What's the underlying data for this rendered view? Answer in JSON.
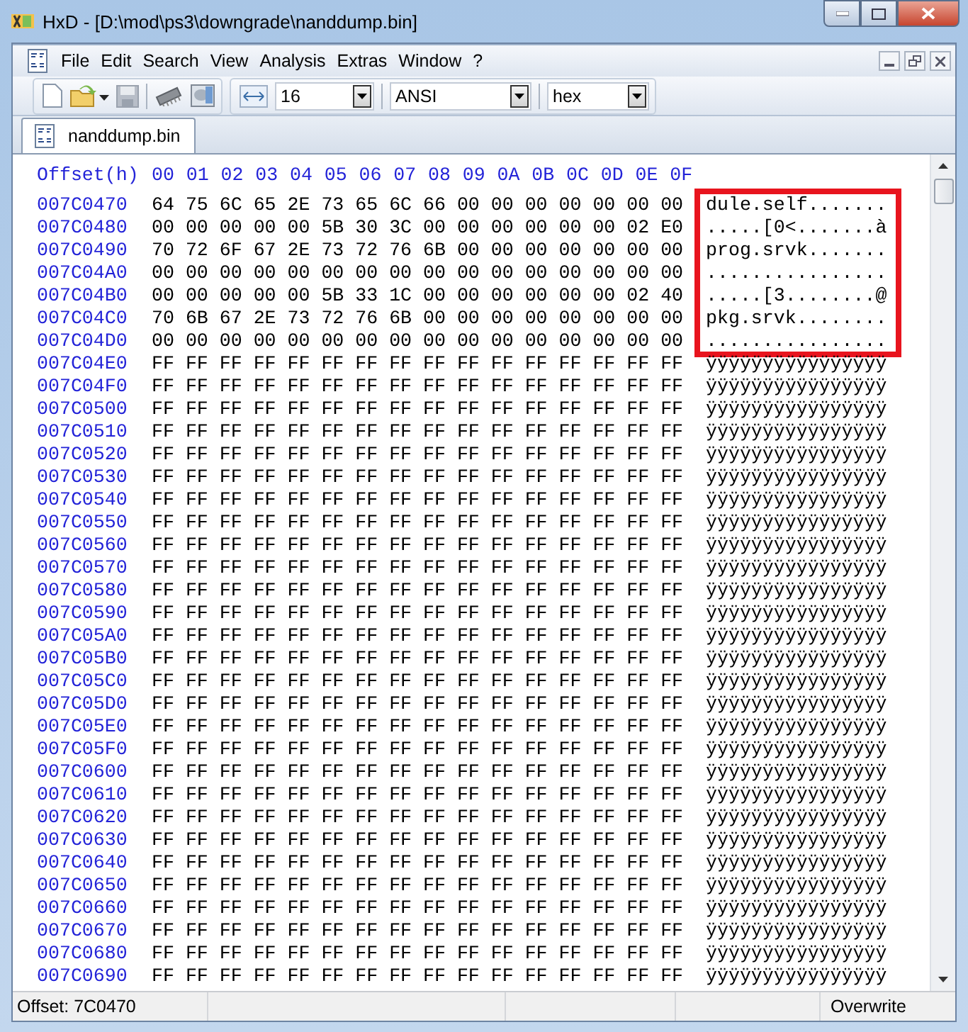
{
  "window": {
    "title": "HxD - [D:\\mod\\ps3\\downgrade\\nanddump.bin]"
  },
  "menu": [
    "File",
    "Edit",
    "Search",
    "View",
    "Analysis",
    "Extras",
    "Window",
    "?"
  ],
  "toolbar": {
    "bytes_per_row": "16",
    "charset": "ANSI",
    "offset_base": "hex"
  },
  "tabs": [
    {
      "label": "nanddump.bin",
      "selected": true
    }
  ],
  "editor": {
    "offset_header": "Offset(h)",
    "columns": [
      "00",
      "01",
      "02",
      "03",
      "04",
      "05",
      "06",
      "07",
      "08",
      "09",
      "0A",
      "0B",
      "0C",
      "0D",
      "0E",
      "0F"
    ],
    "rows": [
      {
        "offset": "007C0470",
        "hex": "64 75 6C 65 2E 73 65 6C 66 00 00 00 00 00 00 00",
        "text": "dule.self.......",
        "highlighted": true
      },
      {
        "offset": "007C0480",
        "hex": "00 00 00 00 00 5B 30 3C 00 00 00 00 00 00 02 E0",
        "text": ".....[0<.......à",
        "highlighted": true
      },
      {
        "offset": "007C0490",
        "hex": "70 72 6F 67 2E 73 72 76 6B 00 00 00 00 00 00 00",
        "text": "prog.srvk.......",
        "highlighted": true
      },
      {
        "offset": "007C04A0",
        "hex": "00 00 00 00 00 00 00 00 00 00 00 00 00 00 00 00",
        "text": "................",
        "highlighted": true
      },
      {
        "offset": "007C04B0",
        "hex": "00 00 00 00 00 5B 33 1C 00 00 00 00 00 00 02 40",
        "text": ".....[3........@",
        "highlighted": true
      },
      {
        "offset": "007C04C0",
        "hex": "70 6B 67 2E 73 72 76 6B 00 00 00 00 00 00 00 00",
        "text": "pkg.srvk........",
        "highlighted": true
      },
      {
        "offset": "007C04D0",
        "hex": "00 00 00 00 00 00 00 00 00 00 00 00 00 00 00 00",
        "text": "................",
        "highlighted": true
      },
      {
        "offset": "007C04E0",
        "hex": "FF FF FF FF FF FF FF FF FF FF FF FF FF FF FF FF",
        "text": "ÿÿÿÿÿÿÿÿÿÿÿÿÿÿÿÿ",
        "highlighted": false
      },
      {
        "offset": "007C04F0",
        "hex": "FF FF FF FF FF FF FF FF FF FF FF FF FF FF FF FF",
        "text": "ÿÿÿÿÿÿÿÿÿÿÿÿÿÿÿÿ",
        "highlighted": false
      },
      {
        "offset": "007C0500",
        "hex": "FF FF FF FF FF FF FF FF FF FF FF FF FF FF FF FF",
        "text": "ÿÿÿÿÿÿÿÿÿÿÿÿÿÿÿÿ",
        "highlighted": false
      },
      {
        "offset": "007C0510",
        "hex": "FF FF FF FF FF FF FF FF FF FF FF FF FF FF FF FF",
        "text": "ÿÿÿÿÿÿÿÿÿÿÿÿÿÿÿÿ",
        "highlighted": false
      },
      {
        "offset": "007C0520",
        "hex": "FF FF FF FF FF FF FF FF FF FF FF FF FF FF FF FF",
        "text": "ÿÿÿÿÿÿÿÿÿÿÿÿÿÿÿÿ",
        "highlighted": false
      },
      {
        "offset": "007C0530",
        "hex": "FF FF FF FF FF FF FF FF FF FF FF FF FF FF FF FF",
        "text": "ÿÿÿÿÿÿÿÿÿÿÿÿÿÿÿÿ",
        "highlighted": false
      },
      {
        "offset": "007C0540",
        "hex": "FF FF FF FF FF FF FF FF FF FF FF FF FF FF FF FF",
        "text": "ÿÿÿÿÿÿÿÿÿÿÿÿÿÿÿÿ",
        "highlighted": false
      },
      {
        "offset": "007C0550",
        "hex": "FF FF FF FF FF FF FF FF FF FF FF FF FF FF FF FF",
        "text": "ÿÿÿÿÿÿÿÿÿÿÿÿÿÿÿÿ",
        "highlighted": false
      },
      {
        "offset": "007C0560",
        "hex": "FF FF FF FF FF FF FF FF FF FF FF FF FF FF FF FF",
        "text": "ÿÿÿÿÿÿÿÿÿÿÿÿÿÿÿÿ",
        "highlighted": false
      },
      {
        "offset": "007C0570",
        "hex": "FF FF FF FF FF FF FF FF FF FF FF FF FF FF FF FF",
        "text": "ÿÿÿÿÿÿÿÿÿÿÿÿÿÿÿÿ",
        "highlighted": false
      },
      {
        "offset": "007C0580",
        "hex": "FF FF FF FF FF FF FF FF FF FF FF FF FF FF FF FF",
        "text": "ÿÿÿÿÿÿÿÿÿÿÿÿÿÿÿÿ",
        "highlighted": false
      },
      {
        "offset": "007C0590",
        "hex": "FF FF FF FF FF FF FF FF FF FF FF FF FF FF FF FF",
        "text": "ÿÿÿÿÿÿÿÿÿÿÿÿÿÿÿÿ",
        "highlighted": false
      },
      {
        "offset": "007C05A0",
        "hex": "FF FF FF FF FF FF FF FF FF FF FF FF FF FF FF FF",
        "text": "ÿÿÿÿÿÿÿÿÿÿÿÿÿÿÿÿ",
        "highlighted": false
      },
      {
        "offset": "007C05B0",
        "hex": "FF FF FF FF FF FF FF FF FF FF FF FF FF FF FF FF",
        "text": "ÿÿÿÿÿÿÿÿÿÿÿÿÿÿÿÿ",
        "highlighted": false
      },
      {
        "offset": "007C05C0",
        "hex": "FF FF FF FF FF FF FF FF FF FF FF FF FF FF FF FF",
        "text": "ÿÿÿÿÿÿÿÿÿÿÿÿÿÿÿÿ",
        "highlighted": false
      },
      {
        "offset": "007C05D0",
        "hex": "FF FF FF FF FF FF FF FF FF FF FF FF FF FF FF FF",
        "text": "ÿÿÿÿÿÿÿÿÿÿÿÿÿÿÿÿ",
        "highlighted": false
      },
      {
        "offset": "007C05E0",
        "hex": "FF FF FF FF FF FF FF FF FF FF FF FF FF FF FF FF",
        "text": "ÿÿÿÿÿÿÿÿÿÿÿÿÿÿÿÿ",
        "highlighted": false
      },
      {
        "offset": "007C05F0",
        "hex": "FF FF FF FF FF FF FF FF FF FF FF FF FF FF FF FF",
        "text": "ÿÿÿÿÿÿÿÿÿÿÿÿÿÿÿÿ",
        "highlighted": false
      },
      {
        "offset": "007C0600",
        "hex": "FF FF FF FF FF FF FF FF FF FF FF FF FF FF FF FF",
        "text": "ÿÿÿÿÿÿÿÿÿÿÿÿÿÿÿÿ",
        "highlighted": false
      },
      {
        "offset": "007C0610",
        "hex": "FF FF FF FF FF FF FF FF FF FF FF FF FF FF FF FF",
        "text": "ÿÿÿÿÿÿÿÿÿÿÿÿÿÿÿÿ",
        "highlighted": false
      },
      {
        "offset": "007C0620",
        "hex": "FF FF FF FF FF FF FF FF FF FF FF FF FF FF FF FF",
        "text": "ÿÿÿÿÿÿÿÿÿÿÿÿÿÿÿÿ",
        "highlighted": false
      },
      {
        "offset": "007C0630",
        "hex": "FF FF FF FF FF FF FF FF FF FF FF FF FF FF FF FF",
        "text": "ÿÿÿÿÿÿÿÿÿÿÿÿÿÿÿÿ",
        "highlighted": false
      },
      {
        "offset": "007C0640",
        "hex": "FF FF FF FF FF FF FF FF FF FF FF FF FF FF FF FF",
        "text": "ÿÿÿÿÿÿÿÿÿÿÿÿÿÿÿÿ",
        "highlighted": false
      },
      {
        "offset": "007C0650",
        "hex": "FF FF FF FF FF FF FF FF FF FF FF FF FF FF FF FF",
        "text": "ÿÿÿÿÿÿÿÿÿÿÿÿÿÿÿÿ",
        "highlighted": false
      },
      {
        "offset": "007C0660",
        "hex": "FF FF FF FF FF FF FF FF FF FF FF FF FF FF FF FF",
        "text": "ÿÿÿÿÿÿÿÿÿÿÿÿÿÿÿÿ",
        "highlighted": false
      },
      {
        "offset": "007C0670",
        "hex": "FF FF FF FF FF FF FF FF FF FF FF FF FF FF FF FF",
        "text": "ÿÿÿÿÿÿÿÿÿÿÿÿÿÿÿÿ",
        "highlighted": false
      },
      {
        "offset": "007C0680",
        "hex": "FF FF FF FF FF FF FF FF FF FF FF FF FF FF FF FF",
        "text": "ÿÿÿÿÿÿÿÿÿÿÿÿÿÿÿÿ",
        "highlighted": false
      },
      {
        "offset": "007C0690",
        "hex": "FF FF FF FF FF FF FF FF FF FF FF FF FF FF FF FF",
        "text": "ÿÿÿÿÿÿÿÿÿÿÿÿÿÿÿÿ",
        "highlighted": false
      }
    ]
  },
  "status_bar": {
    "offset": "Offset: 7C0470",
    "mode": "Overwrite"
  }
}
